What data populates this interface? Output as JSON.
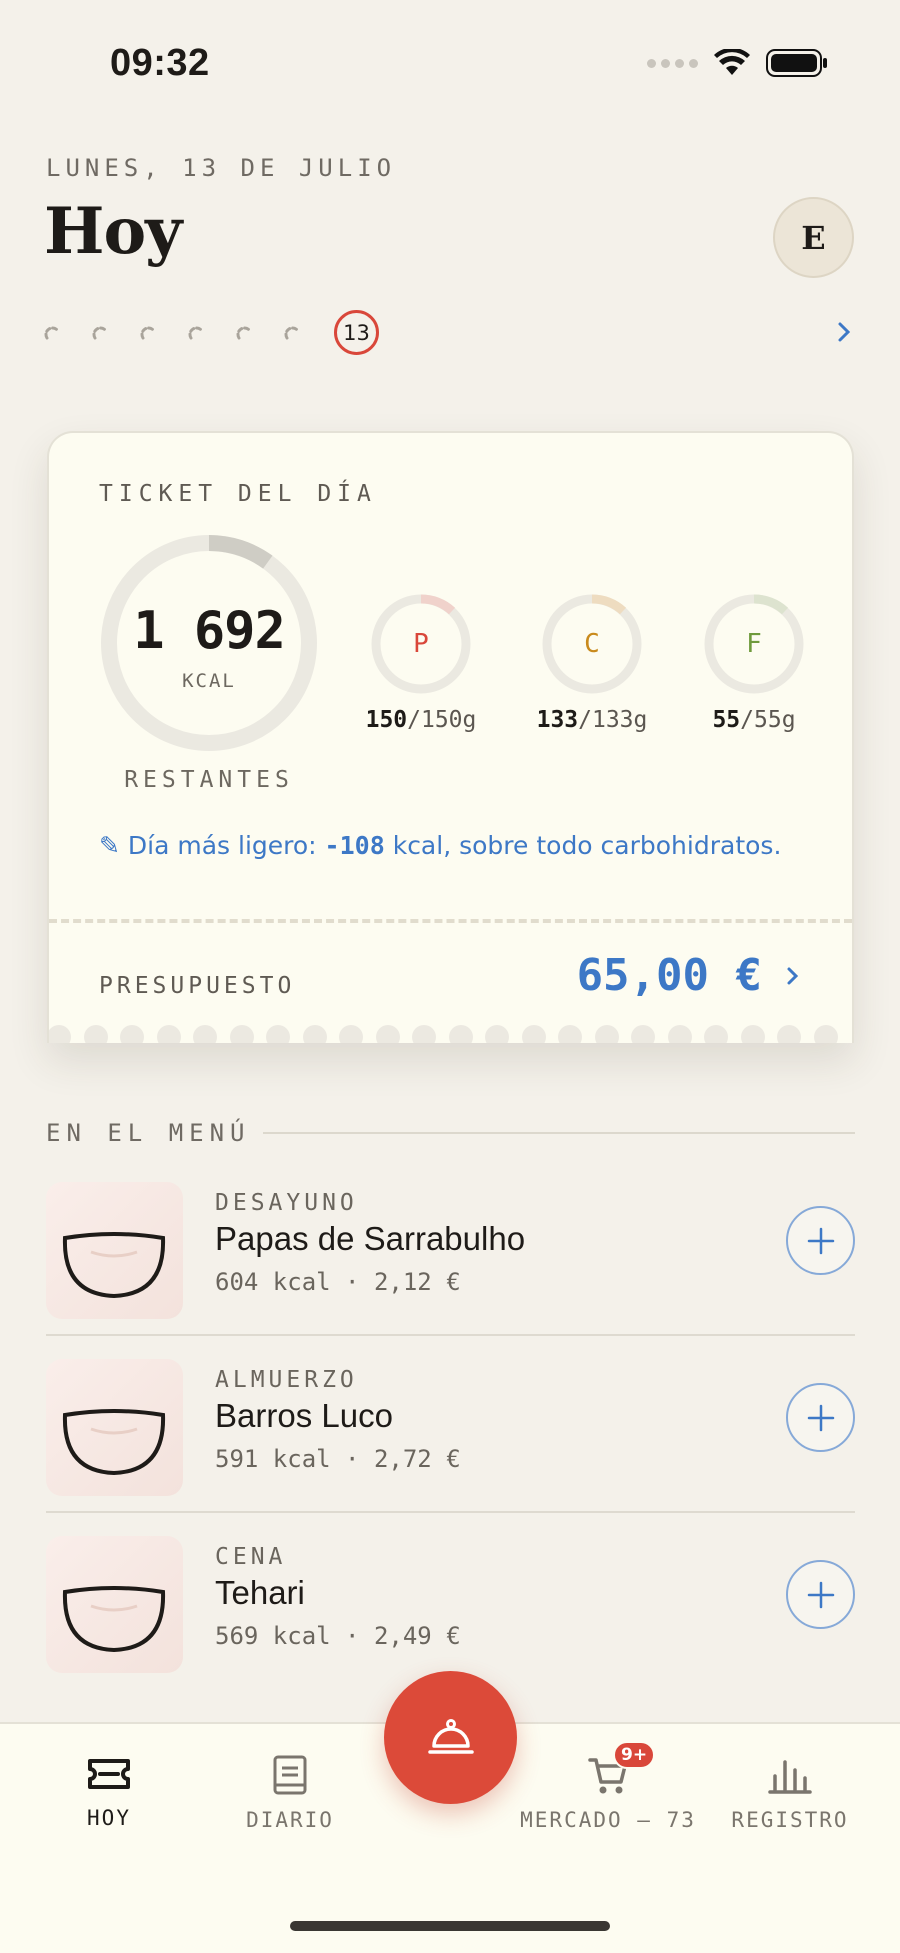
{
  "status_bar": {
    "time": "09:32"
  },
  "header": {
    "date": "LUNES, 13 DE JULIO",
    "title": "Hoy",
    "avatar_initial": "E",
    "current_day": "13"
  },
  "ticket": {
    "label": "TICKET DEL DÍA",
    "kcal_value": "1 692",
    "kcal_unit": "KCAL",
    "kcal_caption": "RESTANTES",
    "kcal_used_fraction": 0.1,
    "macros": [
      {
        "letter": "P",
        "current": "150",
        "target": "/150g",
        "color": "#d9473a"
      },
      {
        "letter": "C",
        "current": "133",
        "target": "/133g",
        "color": "#c98a1c"
      },
      {
        "letter": "F",
        "current": "55",
        "target": "/55g",
        "color": "#6f9a3c"
      }
    ],
    "insight_prefix": "✎ Día más ligero: ",
    "insight_number": "-108",
    "insight_suffix": " kcal, sobre todo carbohidratos.",
    "budget_label": "PRESUPUESTO",
    "budget_value": "65,00 €"
  },
  "menu": {
    "header": "EN EL MENÚ",
    "meals": [
      {
        "type": "DESAYUNO",
        "name": "Papas de Sarrabulho",
        "meta": "604 kcal · 2,12 €"
      },
      {
        "type": "ALMUERZO",
        "name": "Barros Luco",
        "meta": "591 kcal · 2,72 €"
      },
      {
        "type": "CENA",
        "name": "Tehari",
        "meta": "569 kcal · 2,49 €"
      }
    ]
  },
  "tabbar": {
    "tabs": [
      {
        "label": "HOY",
        "icon": "ticket-icon",
        "active": true
      },
      {
        "label": "DIARIO",
        "icon": "book-icon",
        "active": false
      },
      {
        "label": "MERCADO — 73",
        "icon": "cart-icon",
        "active": false
      },
      {
        "label": "REGISTRO",
        "icon": "bar-chart-icon",
        "active": false
      }
    ],
    "cart_badge": "9+",
    "fab_icon": "cloche-icon"
  },
  "colors": {
    "accent_red": "#dc4a39",
    "accent_blue": "#3d78c6",
    "background": "#f4f1ea",
    "card": "#fdfcf1"
  }
}
